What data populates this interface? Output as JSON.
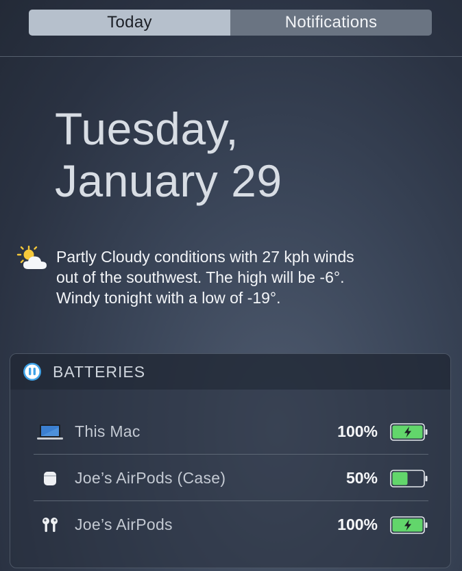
{
  "tabs": [
    {
      "label": "Today",
      "active": true
    },
    {
      "label": "Notifications",
      "active": false
    }
  ],
  "date": {
    "line1": "Tuesday,",
    "line2": "January 29"
  },
  "weather": {
    "icon": "partly-cloudy-icon",
    "line1": "Partly Cloudy conditions with 27 kph winds",
    "line2": "out of the southwest. The high will be -6°.",
    "line3": "Windy tonight with a low of -19°."
  },
  "batteries_widget": {
    "title": "BATTERIES",
    "icon": "airpods-app-icon",
    "devices": [
      {
        "name": "This Mac",
        "percent": "100%",
        "level": 1.0,
        "charging": true,
        "icon": "laptop-icon"
      },
      {
        "name": "Joe’s AirPods  (Case)",
        "percent": "50%",
        "level": 0.5,
        "charging": false,
        "icon": "airpods-case-icon"
      },
      {
        "name": "Joe’s AirPods",
        "percent": "100%",
        "level": 1.0,
        "charging": true,
        "icon": "airpods-icon"
      }
    ]
  },
  "colors": {
    "battery_green": "#62d66b",
    "tab_active": "#b6c0cc",
    "tab_inactive": "#6a7482"
  }
}
